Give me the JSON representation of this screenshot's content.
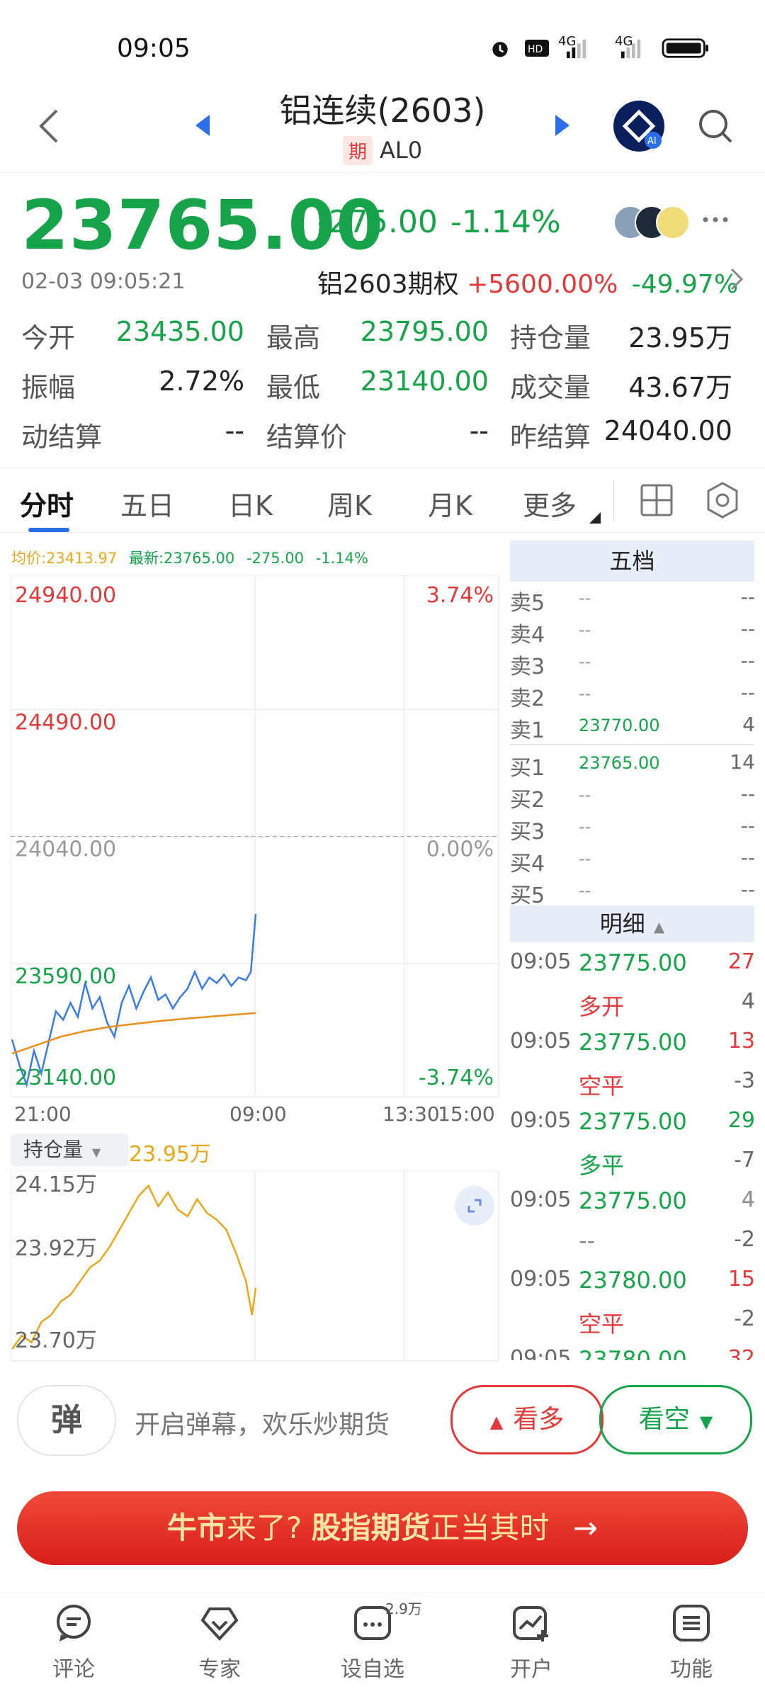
{
  "status_bar": {
    "time": "09:05",
    "signal1": "4G",
    "signal2": "4G"
  },
  "header": {
    "title": "铝连续(2603)",
    "sub_tag": "期",
    "sub_code": "AL0"
  },
  "quote": {
    "last": "23765.00",
    "change": "-275.00",
    "change_pct": "-1.14%",
    "timestamp": "02-03 09:05:21",
    "option_name": "铝2603期权",
    "option_change": "+5600.00%",
    "option_pct": "-49.97%"
  },
  "stats": [
    {
      "label": "今开",
      "value": "23435.00",
      "color": "green"
    },
    {
      "label": "最高",
      "value": "23795.00",
      "color": "green"
    },
    {
      "label": "持仓量",
      "value": "23.95万",
      "color": "dark"
    },
    {
      "label": "振幅",
      "value": "2.72%",
      "color": "dark"
    },
    {
      "label": "最低",
      "value": "23140.00",
      "color": "green"
    },
    {
      "label": "成交量",
      "value": "43.67万",
      "color": "dark"
    },
    {
      "label": "动结算",
      "value": "--",
      "color": "dark"
    },
    {
      "label": "结算价",
      "value": "--",
      "color": "dark"
    },
    {
      "label": "昨结算",
      "value": "24040.00",
      "color": "dark"
    }
  ],
  "tabs": [
    "分时",
    "五日",
    "日K",
    "周K",
    "月K",
    "更多"
  ],
  "chart_legend": {
    "avg": "均价:23413.97",
    "latest": "最新:23765.00",
    "change": "-275.00",
    "pct": "-1.14%"
  },
  "chart_data": [
    {
      "type": "line",
      "title": "",
      "y_labels": [
        "24940.00",
        "24490.00",
        "24040.00",
        "23590.00",
        "23140.00"
      ],
      "pct_labels": [
        "3.74%",
        "0.00%",
        "-3.74%"
      ],
      "x_labels": [
        "21:00",
        "09:00",
        "13:30",
        "15:00"
      ],
      "ylim": [
        23140,
        24940
      ],
      "series": [
        {
          "name": "最新",
          "color": "#3b7be8",
          "x_fraction": [
            0,
            0.03,
            0.06,
            0.09,
            0.12,
            0.15,
            0.18,
            0.21,
            0.24,
            0.27,
            0.3,
            0.33,
            0.36,
            0.39,
            0.42,
            0.45,
            0.48,
            0.51,
            0.54,
            0.57,
            0.6,
            0.63,
            0.66,
            0.69,
            0.72,
            0.75,
            0.78,
            0.81,
            0.84,
            0.87,
            0.9,
            0.93,
            0.96,
            0.98,
            1.0
          ],
          "values": [
            23320,
            23230,
            23160,
            23280,
            23200,
            23310,
            23420,
            23390,
            23450,
            23400,
            23520,
            23430,
            23470,
            23380,
            23330,
            23450,
            23510,
            23430,
            23490,
            23540,
            23460,
            23480,
            23430,
            23470,
            23500,
            23560,
            23500,
            23540,
            23520,
            23550,
            23510,
            23540,
            23530,
            23560,
            23765
          ]
        },
        {
          "name": "均价",
          "color": "#e8901c",
          "x_fraction": [
            0,
            0.1,
            0.2,
            0.3,
            0.4,
            0.5,
            0.6,
            0.7,
            0.8,
            0.9,
            1.0
          ],
          "values": [
            23270,
            23300,
            23330,
            23350,
            23365,
            23375,
            23385,
            23393,
            23400,
            23407,
            23414
          ]
        }
      ]
    },
    {
      "type": "line",
      "title": "",
      "y_labels": [
        "24.15万",
        "23.92万",
        "23.70万"
      ],
      "series": [
        {
          "name": "持仓量",
          "color": "#e8a71c",
          "x_fraction": [
            0,
            0.04,
            0.08,
            0.12,
            0.16,
            0.2,
            0.24,
            0.28,
            0.32,
            0.36,
            0.4,
            0.44,
            0.48,
            0.52,
            0.56,
            0.6,
            0.64,
            0.68,
            0.72,
            0.76,
            0.8,
            0.84,
            0.88,
            0.92,
            0.96,
            0.985,
            1.0
          ],
          "values": [
            23.7,
            23.74,
            23.72,
            23.78,
            23.8,
            23.84,
            23.86,
            23.9,
            23.94,
            23.96,
            24.0,
            24.05,
            24.1,
            24.15,
            24.18,
            24.12,
            24.16,
            24.11,
            24.09,
            24.14,
            24.1,
            24.08,
            24.05,
            23.98,
            23.9,
            23.8,
            23.88
          ]
        }
      ]
    }
  ],
  "oi_selector": {
    "label": "持仓量",
    "value": "23.95万"
  },
  "order_book": {
    "title": "五档",
    "asks": [
      {
        "label": "卖5",
        "price": "--",
        "qty": "--"
      },
      {
        "label": "卖4",
        "price": "--",
        "qty": "--"
      },
      {
        "label": "卖3",
        "price": "--",
        "qty": "--"
      },
      {
        "label": "卖2",
        "price": "--",
        "qty": "--"
      },
      {
        "label": "卖1",
        "price": "23770.00",
        "qty": "4"
      }
    ],
    "bids": [
      {
        "label": "买1",
        "price": "23765.00",
        "qty": "14"
      },
      {
        "label": "买2",
        "price": "--",
        "qty": "--"
      },
      {
        "label": "买3",
        "price": "--",
        "qty": "--"
      },
      {
        "label": "买4",
        "price": "--",
        "qty": "--"
      },
      {
        "label": "买5",
        "price": "--",
        "qty": "--"
      }
    ]
  },
  "details": {
    "title": "明细",
    "rows": [
      {
        "time": "09:05",
        "price": "23775.00",
        "qty": "27",
        "qty_color": "red",
        "type": "多开",
        "type_color": "red",
        "change": "4"
      },
      {
        "time": "09:05",
        "price": "23775.00",
        "qty": "13",
        "qty_color": "red",
        "type": "空平",
        "type_color": "red",
        "change": "-3"
      },
      {
        "time": "09:05",
        "price": "23775.00",
        "qty": "29",
        "qty_color": "green",
        "type": "多平",
        "type_color": "green",
        "change": "-7"
      },
      {
        "time": "09:05",
        "price": "23775.00",
        "qty": "4",
        "qty_color": "gray",
        "type": "--",
        "type_color": "gray",
        "change": "-2"
      },
      {
        "time": "09:05",
        "price": "23780.00",
        "qty": "15",
        "qty_color": "red",
        "type": "空平",
        "type_color": "red",
        "change": "-2"
      },
      {
        "time": "09:05",
        "price": "23780.00",
        "qty": "32",
        "qty_color": "red",
        "type": "",
        "type_color": "red",
        "change": ""
      }
    ]
  },
  "bottom": {
    "danmaku_icon": "弹",
    "danmaku_text": "开启弹幕，欢乐炒期货",
    "bull": "看多",
    "bear": "看空"
  },
  "banner": {
    "part1": "牛市",
    "part2": "来了?",
    "part3": "股指期货",
    "part4": "正当其时",
    "arrow": "→"
  },
  "nav": [
    {
      "label": "评论",
      "icon": "comment-icon"
    },
    {
      "label": "专家",
      "icon": "expert-icon"
    },
    {
      "label": "设自选",
      "icon": "watchlist-icon",
      "badge": "2.9万"
    },
    {
      "label": "开户",
      "icon": "open-account-icon"
    },
    {
      "label": "功能",
      "icon": "menu-icon"
    }
  ]
}
